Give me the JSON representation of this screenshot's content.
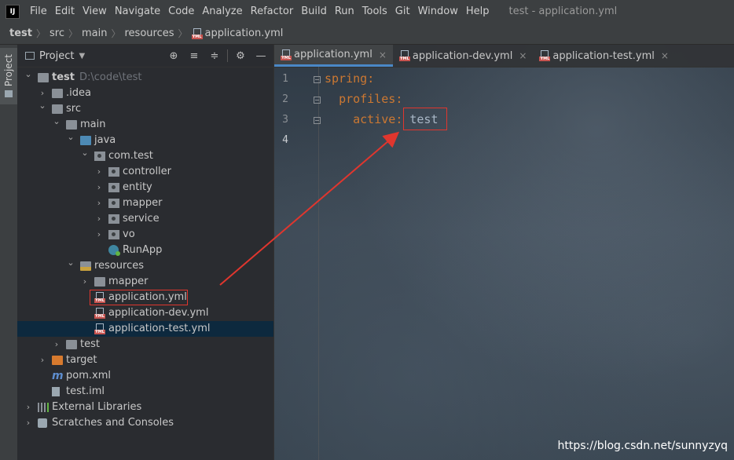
{
  "menubar": {
    "logo": "IJ",
    "items": [
      "File",
      "Edit",
      "View",
      "Navigate",
      "Code",
      "Analyze",
      "Refactor",
      "Build",
      "Run",
      "Tools",
      "Git",
      "Window",
      "Help"
    ],
    "window_title": "test - application.yml"
  },
  "breadcrumb": [
    "test",
    "src",
    "main",
    "resources",
    "application.yml"
  ],
  "sidebar": {
    "tab_label": "Project"
  },
  "project_panel": {
    "title": "Project",
    "header_icons": [
      "crosshair-icon",
      "expand-all-icon",
      "collapse-all-icon",
      "gear-icon",
      "minimize-icon"
    ],
    "tree": [
      {
        "label": "test",
        "path": "D:\\code\\test",
        "depth": 0,
        "arrow": "down",
        "icon": "folder",
        "bold": true
      },
      {
        "label": ".idea",
        "depth": 1,
        "arrow": "right",
        "icon": "folder"
      },
      {
        "label": "src",
        "depth": 1,
        "arrow": "down",
        "icon": "folder"
      },
      {
        "label": "main",
        "depth": 2,
        "arrow": "down",
        "icon": "folder"
      },
      {
        "label": "java",
        "depth": 3,
        "arrow": "down",
        "icon": "folder-blue"
      },
      {
        "label": "com.test",
        "depth": 4,
        "arrow": "down",
        "icon": "package"
      },
      {
        "label": "controller",
        "depth": 5,
        "arrow": "right",
        "icon": "package"
      },
      {
        "label": "entity",
        "depth": 5,
        "arrow": "right",
        "icon": "package"
      },
      {
        "label": "mapper",
        "depth": 5,
        "arrow": "right",
        "icon": "package"
      },
      {
        "label": "service",
        "depth": 5,
        "arrow": "right",
        "icon": "package"
      },
      {
        "label": "vo",
        "depth": 5,
        "arrow": "right",
        "icon": "package"
      },
      {
        "label": "RunApp",
        "depth": 5,
        "arrow": "",
        "icon": "class"
      },
      {
        "label": "resources",
        "depth": 3,
        "arrow": "down",
        "icon": "folder-res"
      },
      {
        "label": "mapper",
        "depth": 4,
        "arrow": "right",
        "icon": "folder"
      },
      {
        "label": "application.yml",
        "depth": 4,
        "arrow": "",
        "icon": "yml",
        "highlighted": true
      },
      {
        "label": "application-dev.yml",
        "depth": 4,
        "arrow": "",
        "icon": "yml"
      },
      {
        "label": "application-test.yml",
        "depth": 4,
        "arrow": "",
        "icon": "yml",
        "selected": true
      },
      {
        "label": "test",
        "depth": 2,
        "arrow": "right",
        "icon": "folder"
      },
      {
        "label": "target",
        "depth": 1,
        "arrow": "right",
        "icon": "folder-orange"
      },
      {
        "label": "pom.xml",
        "depth": 1,
        "arrow": "",
        "icon": "maven"
      },
      {
        "label": "test.iml",
        "depth": 1,
        "arrow": "",
        "icon": "iml"
      },
      {
        "label": "External Libraries",
        "depth": 0,
        "arrow": "right",
        "icon": "libraries"
      },
      {
        "label": "Scratches and Consoles",
        "depth": 0,
        "arrow": "right",
        "icon": "scratches"
      }
    ]
  },
  "editor": {
    "tabs": [
      {
        "label": "application.yml",
        "active": true,
        "closable": true
      },
      {
        "label": "application-dev.yml",
        "active": false,
        "closable": true
      },
      {
        "label": "application-test.yml",
        "active": false,
        "closable": true
      }
    ],
    "lines": [
      {
        "no": "1",
        "indent": "",
        "key": "spring",
        "value": ""
      },
      {
        "no": "2",
        "indent": "  ",
        "key": "profiles",
        "value": ""
      },
      {
        "no": "3",
        "indent": "    ",
        "key": "active",
        "value": "test"
      },
      {
        "no": "4",
        "indent": "",
        "key": "",
        "value": ""
      }
    ],
    "current_line": "4"
  },
  "watermark": "https://blog.csdn.net/sunnyzyq",
  "colors": {
    "highlight_box": "#e0362e",
    "yaml_key": "#cc7832",
    "selection": "#0d293e"
  }
}
